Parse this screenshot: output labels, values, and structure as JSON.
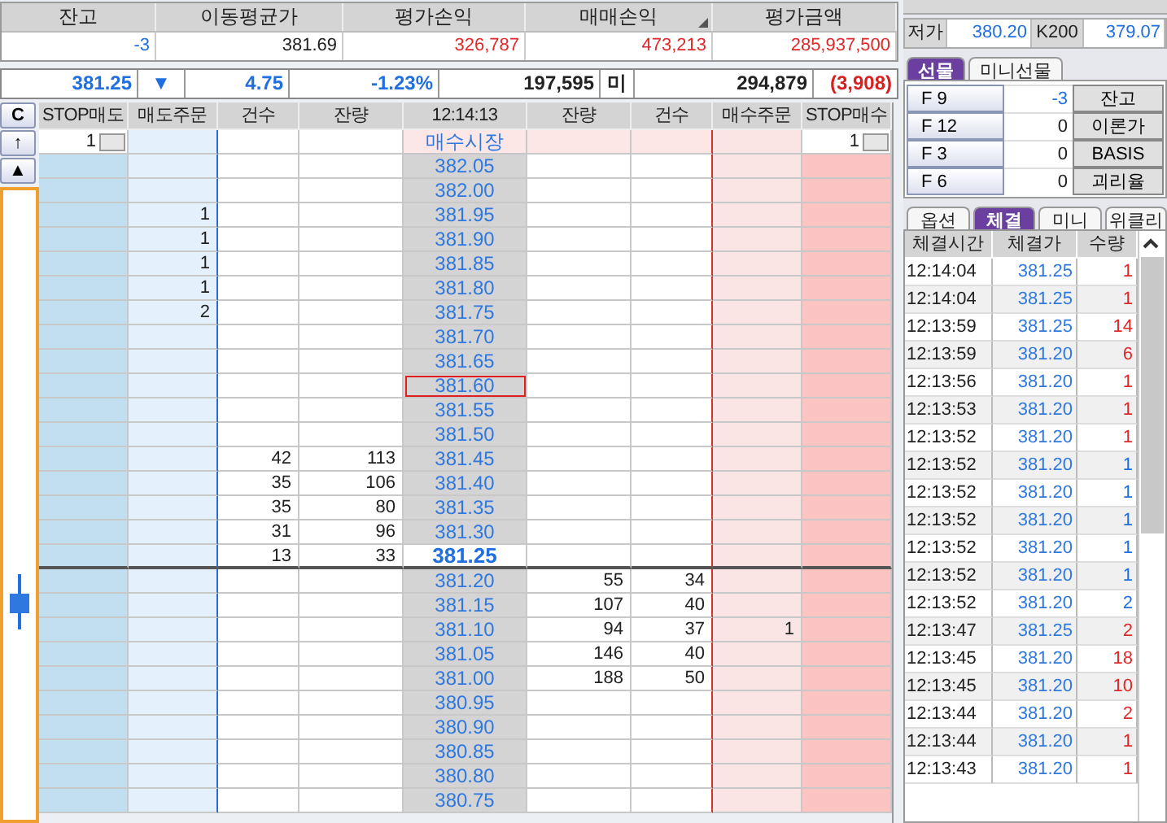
{
  "summary": {
    "columns": [
      "잔고",
      "이동평균가",
      "평가손익",
      "매매손익",
      "평가금액"
    ],
    "values": [
      {
        "text": "-3",
        "color": "#1f6fe0"
      },
      {
        "text": "381.69",
        "color": "#222222"
      },
      {
        "text": "326,787",
        "color": "#e02828"
      },
      {
        "text": "473,213",
        "color": "#e02828"
      },
      {
        "text": "285,937,500",
        "color": "#e02828"
      }
    ]
  },
  "price_bar": {
    "price": "381.25",
    "arrow": "▼",
    "change": "4.75",
    "rate": "-1.23%",
    "volume": "197,595",
    "label": "미",
    "open_interest": "294,879",
    "oi_change": "(3,908)"
  },
  "order_book": {
    "clear_button": "C",
    "columns": [
      "STOP매도",
      "매도주문",
      "건수",
      "잔량",
      "12:14:13",
      "잔량",
      "건수",
      "매수주문",
      "STOP매수"
    ],
    "up_button": "↑",
    "top_button": "▲",
    "stop_sell_qty": "1",
    "market_label": "매수시장",
    "stop_buy_qty": "1",
    "rows": [
      {
        "price": "382.05",
        "kind": "ask",
        "highlighted": false
      },
      {
        "price": "382.00",
        "kind": "ask",
        "highlighted": false
      },
      {
        "price": "381.95",
        "kind": "ask",
        "highlighted": false,
        "sell_order": "1"
      },
      {
        "price": "381.90",
        "kind": "ask",
        "highlighted": false,
        "sell_order": "1"
      },
      {
        "price": "381.85",
        "kind": "ask",
        "highlighted": false,
        "sell_order": "1"
      },
      {
        "price": "381.80",
        "kind": "ask",
        "highlighted": false,
        "sell_order": "1"
      },
      {
        "price": "381.75",
        "kind": "ask",
        "highlighted": false,
        "sell_order": "2"
      },
      {
        "price": "381.70",
        "kind": "ask",
        "highlighted": false
      },
      {
        "price": "381.65",
        "kind": "ask",
        "highlighted": false
      },
      {
        "price": "381.60",
        "kind": "ask",
        "highlighted": true
      },
      {
        "price": "381.55",
        "kind": "ask",
        "highlighted": false
      },
      {
        "price": "381.50",
        "kind": "ask",
        "highlighted": false
      },
      {
        "price": "381.45",
        "kind": "ask",
        "highlighted": false,
        "sell_count": "42",
        "sell_qty": "113"
      },
      {
        "price": "381.40",
        "kind": "ask",
        "highlighted": false,
        "sell_count": "35",
        "sell_qty": "106"
      },
      {
        "price": "381.35",
        "kind": "ask",
        "highlighted": false,
        "sell_count": "35",
        "sell_qty": "80"
      },
      {
        "price": "381.30",
        "kind": "ask",
        "highlighted": false,
        "sell_count": "31",
        "sell_qty": "96"
      },
      {
        "price": "381.25",
        "kind": "current",
        "highlighted": false,
        "sell_count": "13",
        "sell_qty": "33"
      },
      {
        "price": "381.20",
        "kind": "bid",
        "highlighted": false,
        "buy_qty": "55",
        "buy_count": "34"
      },
      {
        "price": "381.15",
        "kind": "bid",
        "highlighted": false,
        "buy_qty": "107",
        "buy_count": "40"
      },
      {
        "price": "381.10",
        "kind": "bid",
        "highlighted": false,
        "buy_qty": "94",
        "buy_count": "37",
        "buy_order": "1"
      },
      {
        "price": "381.05",
        "kind": "bid",
        "highlighted": false,
        "buy_qty": "146",
        "buy_count": "40"
      },
      {
        "price": "381.00",
        "kind": "bid",
        "highlighted": false,
        "buy_qty": "188",
        "buy_count": "50"
      },
      {
        "price": "380.95",
        "kind": "bid",
        "highlighted": false
      },
      {
        "price": "380.90",
        "kind": "bid",
        "highlighted": false
      },
      {
        "price": "380.85",
        "kind": "bid",
        "highlighted": false
      },
      {
        "price": "380.80",
        "kind": "bid",
        "highlighted": false
      },
      {
        "price": "380.75",
        "kind": "bid",
        "highlighted": false
      }
    ]
  },
  "side_panel": {
    "quote": [
      {
        "label": "저가",
        "value": "380.20"
      },
      {
        "label": "K200",
        "value": "379.07"
      }
    ],
    "product_tabs": [
      {
        "label": "선물",
        "selected": true
      },
      {
        "label": "미니선물",
        "selected": false
      }
    ],
    "futures": [
      {
        "key": "F 9",
        "value": "-3",
        "color": "#1f6fe0",
        "button": "잔고"
      },
      {
        "key": "F 12",
        "value": "0",
        "color": "#222222",
        "button": "이론가"
      },
      {
        "key": "F 3",
        "value": "0",
        "color": "#222222",
        "button": "BASIS"
      },
      {
        "key": "F 6",
        "value": "0",
        "color": "#222222",
        "button": "괴리율"
      }
    ],
    "view_tabs": [
      {
        "label": "옵션",
        "selected": false
      },
      {
        "label": "체결",
        "selected": true
      },
      {
        "label": "미니",
        "selected": false
      },
      {
        "label": "위클리",
        "selected": false
      }
    ],
    "trades": {
      "columns": [
        "체결시간",
        "체결가",
        "수량"
      ],
      "rows": [
        {
          "time": "12:14:04",
          "price": "381.25",
          "qty": "1",
          "color": "#e02828"
        },
        {
          "time": "12:14:04",
          "price": "381.25",
          "qty": "1",
          "color": "#e02828"
        },
        {
          "time": "12:13:59",
          "price": "381.25",
          "qty": "14",
          "color": "#e02828"
        },
        {
          "time": "12:13:59",
          "price": "381.20",
          "qty": "6",
          "color": "#e02828"
        },
        {
          "time": "12:13:56",
          "price": "381.20",
          "qty": "1",
          "color": "#e02828"
        },
        {
          "time": "12:13:53",
          "price": "381.20",
          "qty": "1",
          "color": "#e02828"
        },
        {
          "time": "12:13:52",
          "price": "381.20",
          "qty": "1",
          "color": "#e02828"
        },
        {
          "time": "12:13:52",
          "price": "381.20",
          "qty": "1",
          "color": "#1f6fe0"
        },
        {
          "time": "12:13:52",
          "price": "381.20",
          "qty": "1",
          "color": "#1f6fe0"
        },
        {
          "time": "12:13:52",
          "price": "381.20",
          "qty": "1",
          "color": "#1f6fe0"
        },
        {
          "time": "12:13:52",
          "price": "381.20",
          "qty": "1",
          "color": "#1f6fe0"
        },
        {
          "time": "12:13:52",
          "price": "381.20",
          "qty": "1",
          "color": "#1f6fe0"
        },
        {
          "time": "12:13:52",
          "price": "381.20",
          "qty": "2",
          "color": "#1f6fe0"
        },
        {
          "time": "12:13:47",
          "price": "381.25",
          "qty": "2",
          "color": "#e02828"
        },
        {
          "time": "12:13:45",
          "price": "381.20",
          "qty": "18",
          "color": "#e02828"
        },
        {
          "time": "12:13:45",
          "price": "381.20",
          "qty": "10",
          "color": "#e02828"
        },
        {
          "time": "12:13:44",
          "price": "381.20",
          "qty": "2",
          "color": "#e02828"
        },
        {
          "time": "12:13:44",
          "price": "381.20",
          "qty": "1",
          "color": "#e02828"
        },
        {
          "time": "12:13:43",
          "price": "381.20",
          "qty": "1",
          "color": "#e02828"
        }
      ]
    }
  }
}
